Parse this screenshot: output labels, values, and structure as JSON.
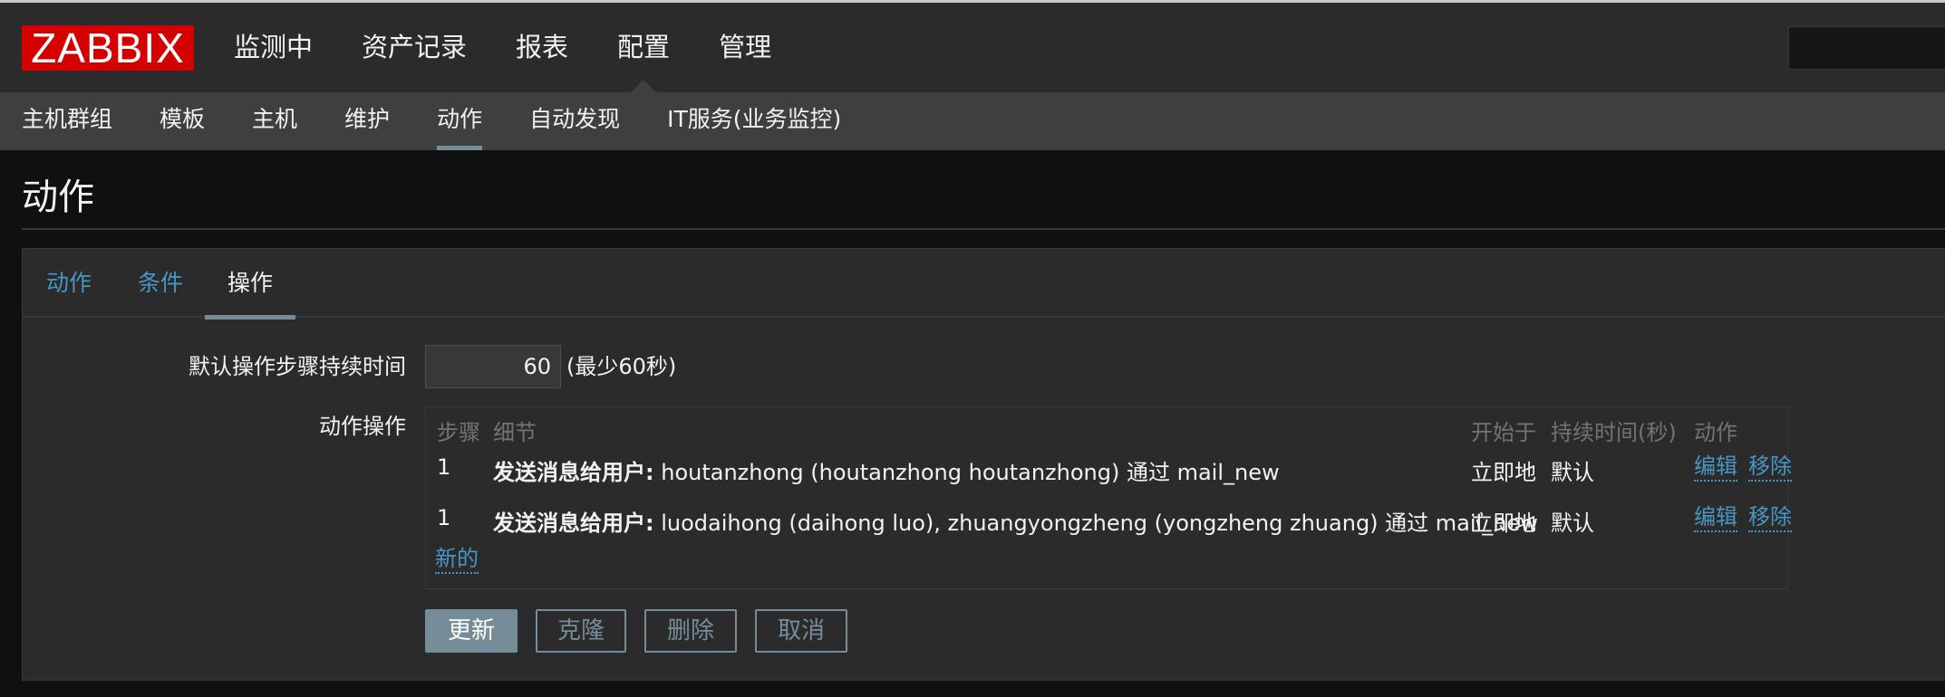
{
  "header": {
    "logo": "ZABBIX",
    "menu": [
      "监测中",
      "资产记录",
      "报表",
      "配置",
      "管理"
    ],
    "active_menu": "配置"
  },
  "submenu": {
    "items": [
      "主机群组",
      "模板",
      "主机",
      "维护",
      "动作",
      "自动发现",
      "IT服务(业务监控)"
    ],
    "active": "动作"
  },
  "page": {
    "title": "动作"
  },
  "tabs": {
    "items": [
      "动作",
      "条件",
      "操作"
    ],
    "active": "操作"
  },
  "form": {
    "default_step_label": "默认操作步骤持续时间",
    "default_step_value": "60",
    "default_step_hint": "(最少60秒)",
    "operations_label": "动作操作"
  },
  "operations_table": {
    "headers": {
      "step": "步骤",
      "detail": "细节",
      "start": "开始于",
      "duration": "持续时间(秒)",
      "action": "动作"
    },
    "rows": [
      {
        "step": "1",
        "detail_bold": "发送消息给用户:",
        "detail_text": " houtanzhong (houtanzhong houtanzhong) 通过 mail_new",
        "start": "立即地",
        "duration": "默认",
        "edit": "编辑",
        "remove": "移除"
      },
      {
        "step": "1",
        "detail_bold": "发送消息给用户:",
        "detail_text": " luodaihong (daihong luo), zhuangyongzheng (yongzheng zhuang) 通过 mail_new",
        "start": "立即地",
        "duration": "默认",
        "edit": "编辑",
        "remove": "移除"
      }
    ],
    "new_link": "新的"
  },
  "buttons": {
    "update": "更新",
    "clone": "克隆",
    "delete": "删除",
    "cancel": "取消"
  },
  "colors": {
    "header_bg": "#2b2b2b",
    "submenu_bg": "#3f3f3f",
    "logo_red": "#d40000",
    "link_blue": "#4796c4",
    "button_accent": "#768d99"
  }
}
